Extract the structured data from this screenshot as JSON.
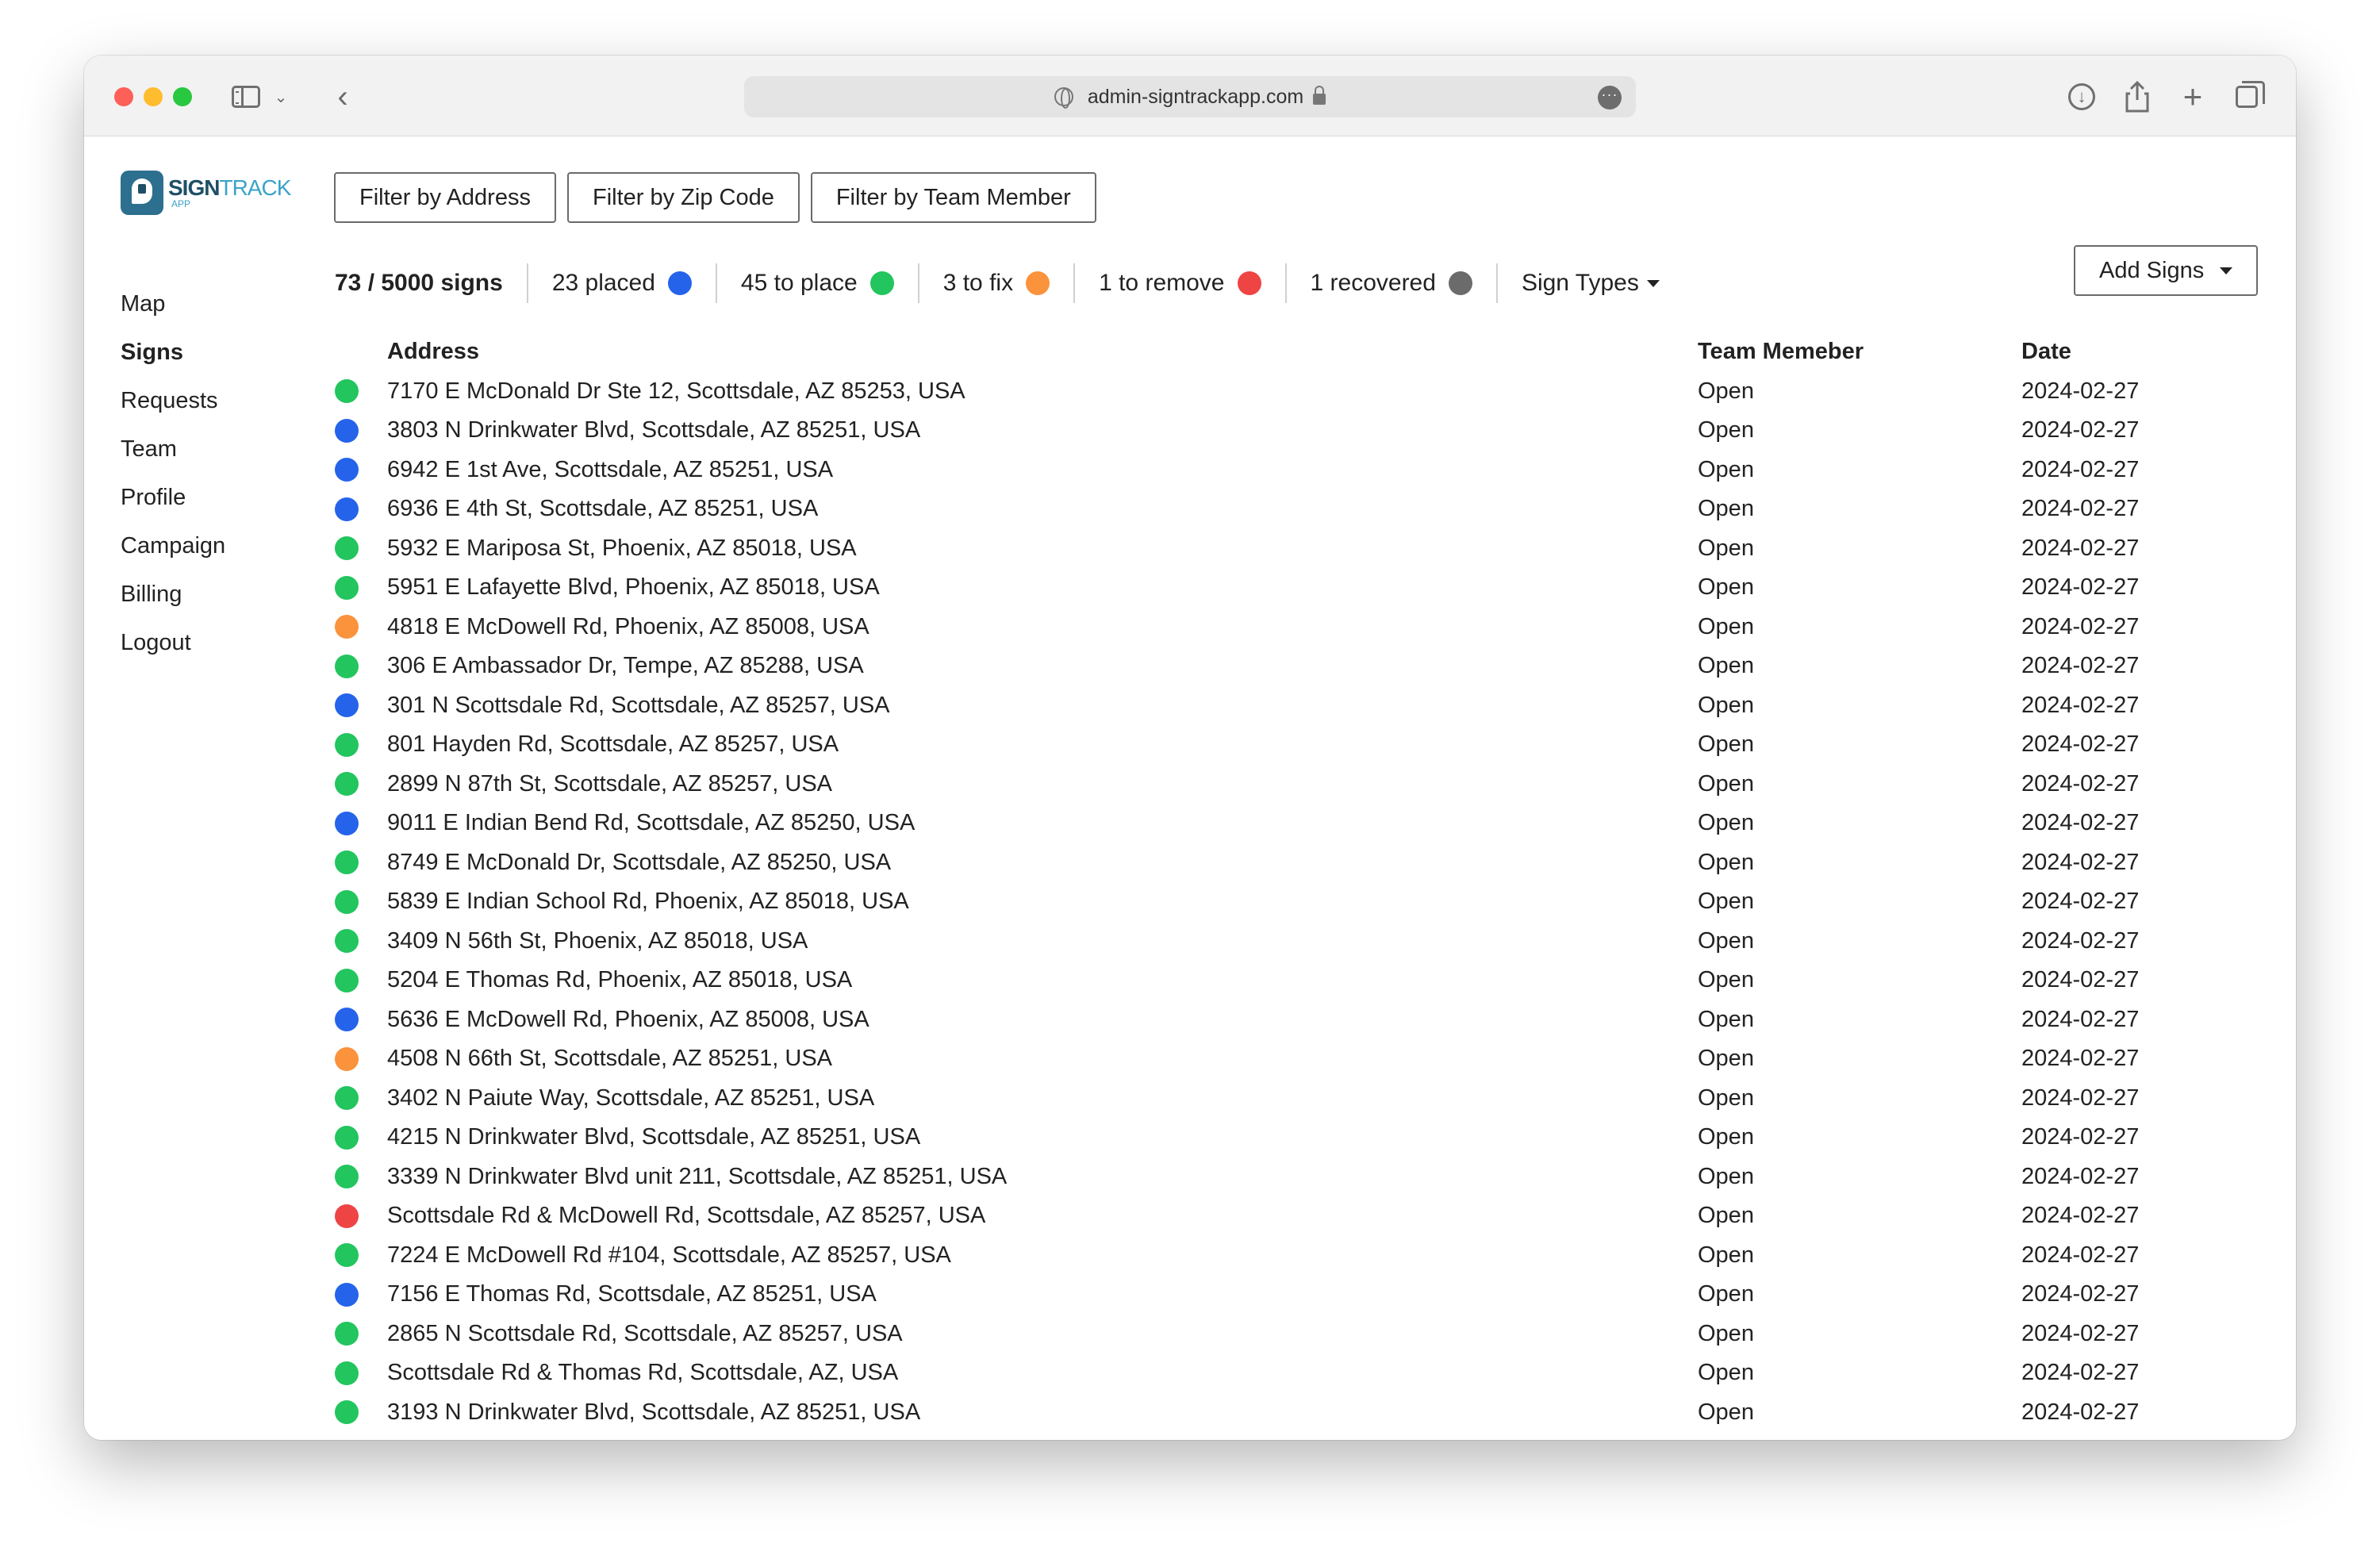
{
  "browser": {
    "url": "admin-signtrackapp.com"
  },
  "colors": {
    "placed": "#2563eb",
    "to_place": "#22c55e",
    "to_fix": "#fb923c",
    "to_remove": "#ef4444",
    "recovered": "#6b6b6b"
  },
  "logo": {
    "sign": "SIGN",
    "track": "TRACK",
    "app": "APP"
  },
  "filters": [
    "Filter by Address",
    "Filter by Zip Code",
    "Filter by Team Member"
  ],
  "nav": [
    "Map",
    "Signs",
    "Requests",
    "Team",
    "Profile",
    "Campaign",
    "Billing",
    "Logout"
  ],
  "stats": {
    "total": "73 / 5000 signs",
    "placed": "23 placed",
    "to_place": "45 to place",
    "to_fix": "3 to fix",
    "to_remove": "1 to remove",
    "recovered": "1 recovered",
    "sign_types": "Sign Types"
  },
  "add_signs": "Add Signs",
  "table": {
    "headers": {
      "address": "Address",
      "team": "Team Memeber",
      "date": "Date"
    },
    "rows": [
      {
        "status": "to_place",
        "address": "7170 E McDonald Dr Ste 12, Scottsdale, AZ 85253, USA",
        "team": "Open",
        "date": "2024-02-27"
      },
      {
        "status": "placed",
        "address": "3803 N Drinkwater Blvd, Scottsdale, AZ 85251, USA",
        "team": "Open",
        "date": "2024-02-27"
      },
      {
        "status": "placed",
        "address": "6942 E 1st Ave, Scottsdale, AZ 85251, USA",
        "team": "Open",
        "date": "2024-02-27"
      },
      {
        "status": "placed",
        "address": "6936 E 4th St, Scottsdale, AZ 85251, USA",
        "team": "Open",
        "date": "2024-02-27"
      },
      {
        "status": "to_place",
        "address": "5932 E Mariposa St, Phoenix, AZ 85018, USA",
        "team": "Open",
        "date": "2024-02-27"
      },
      {
        "status": "to_place",
        "address": "5951 E Lafayette Blvd, Phoenix, AZ 85018, USA",
        "team": "Open",
        "date": "2024-02-27"
      },
      {
        "status": "to_fix",
        "address": "4818 E McDowell Rd, Phoenix, AZ 85008, USA",
        "team": "Open",
        "date": "2024-02-27"
      },
      {
        "status": "to_place",
        "address": "306 E Ambassador Dr, Tempe, AZ 85288, USA",
        "team": "Open",
        "date": "2024-02-27"
      },
      {
        "status": "placed",
        "address": "301 N Scottsdale Rd, Scottsdale, AZ 85257, USA",
        "team": "Open",
        "date": "2024-02-27"
      },
      {
        "status": "to_place",
        "address": "801 Hayden Rd, Scottsdale, AZ 85257, USA",
        "team": "Open",
        "date": "2024-02-27"
      },
      {
        "status": "to_place",
        "address": "2899 N 87th St, Scottsdale, AZ 85257, USA",
        "team": "Open",
        "date": "2024-02-27"
      },
      {
        "status": "placed",
        "address": "9011 E Indian Bend Rd, Scottsdale, AZ 85250, USA",
        "team": "Open",
        "date": "2024-02-27"
      },
      {
        "status": "to_place",
        "address": "8749 E McDonald Dr, Scottsdale, AZ 85250, USA",
        "team": "Open",
        "date": "2024-02-27"
      },
      {
        "status": "to_place",
        "address": "5839 E Indian School Rd, Phoenix, AZ 85018, USA",
        "team": "Open",
        "date": "2024-02-27"
      },
      {
        "status": "to_place",
        "address": "3409 N 56th St, Phoenix, AZ 85018, USA",
        "team": "Open",
        "date": "2024-02-27"
      },
      {
        "status": "to_place",
        "address": "5204 E Thomas Rd, Phoenix, AZ 85018, USA",
        "team": "Open",
        "date": "2024-02-27"
      },
      {
        "status": "placed",
        "address": "5636 E McDowell Rd, Phoenix, AZ 85008, USA",
        "team": "Open",
        "date": "2024-02-27"
      },
      {
        "status": "to_fix",
        "address": "4508 N 66th St, Scottsdale, AZ 85251, USA",
        "team": "Open",
        "date": "2024-02-27"
      },
      {
        "status": "to_place",
        "address": "3402 N Paiute Way, Scottsdale, AZ 85251, USA",
        "team": "Open",
        "date": "2024-02-27"
      },
      {
        "status": "to_place",
        "address": "4215 N Drinkwater Blvd, Scottsdale, AZ 85251, USA",
        "team": "Open",
        "date": "2024-02-27"
      },
      {
        "status": "to_place",
        "address": "3339 N Drinkwater Blvd unit 211, Scottsdale, AZ 85251, USA",
        "team": "Open",
        "date": "2024-02-27"
      },
      {
        "status": "to_remove",
        "address": "Scottsdale Rd & McDowell Rd, Scottsdale, AZ 85257, USA",
        "team": "Open",
        "date": "2024-02-27"
      },
      {
        "status": "to_place",
        "address": "7224 E McDowell Rd #104, Scottsdale, AZ 85257, USA",
        "team": "Open",
        "date": "2024-02-27"
      },
      {
        "status": "placed",
        "address": "7156 E Thomas Rd, Scottsdale, AZ 85251, USA",
        "team": "Open",
        "date": "2024-02-27"
      },
      {
        "status": "to_place",
        "address": "2865 N Scottsdale Rd, Scottsdale, AZ 85257, USA",
        "team": "Open",
        "date": "2024-02-27"
      },
      {
        "status": "to_place",
        "address": "Scottsdale Rd & Thomas Rd, Scottsdale, AZ, USA",
        "team": "Open",
        "date": "2024-02-27"
      },
      {
        "status": "to_place",
        "address": "3193 N Drinkwater Blvd, Scottsdale, AZ 85251, USA",
        "team": "Open",
        "date": "2024-02-27"
      }
    ]
  }
}
